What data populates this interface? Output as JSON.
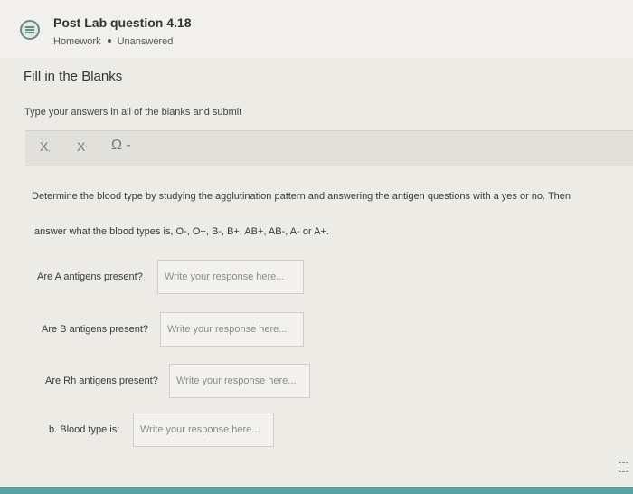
{
  "header": {
    "title": "Post Lab question 4.18",
    "type": "Homework",
    "status": "Unanswered"
  },
  "section_title": "Fill in the Blanks",
  "instructions": "Type your answers in all of the blanks and submit",
  "toolbar": {
    "subscript_label": "X",
    "subscript_mark": ",",
    "superscript_label": "X",
    "superscript_mark": "'",
    "special_chars_label": "Ω -"
  },
  "prompt": {
    "line1": "Determine the blood type by studying the agglutination pattern and answering the antigen questions with a yes or no. Then",
    "line2": "answer what the blood types is, O-, O+, B-, B+, AB+, AB-, A- or A+."
  },
  "questions": [
    {
      "label": "Are A antigens present?",
      "placeholder": "Write your response here..."
    },
    {
      "label": "Are B antigens present?",
      "placeholder": "Write your response here..."
    },
    {
      "label": "Are Rh antigens present?",
      "placeholder": "Write your response here..."
    },
    {
      "label": "b. Blood type is:",
      "placeholder": "Write your response here..."
    }
  ],
  "colors": {
    "accent": "#59a0a0",
    "background": "#ecebe6"
  }
}
